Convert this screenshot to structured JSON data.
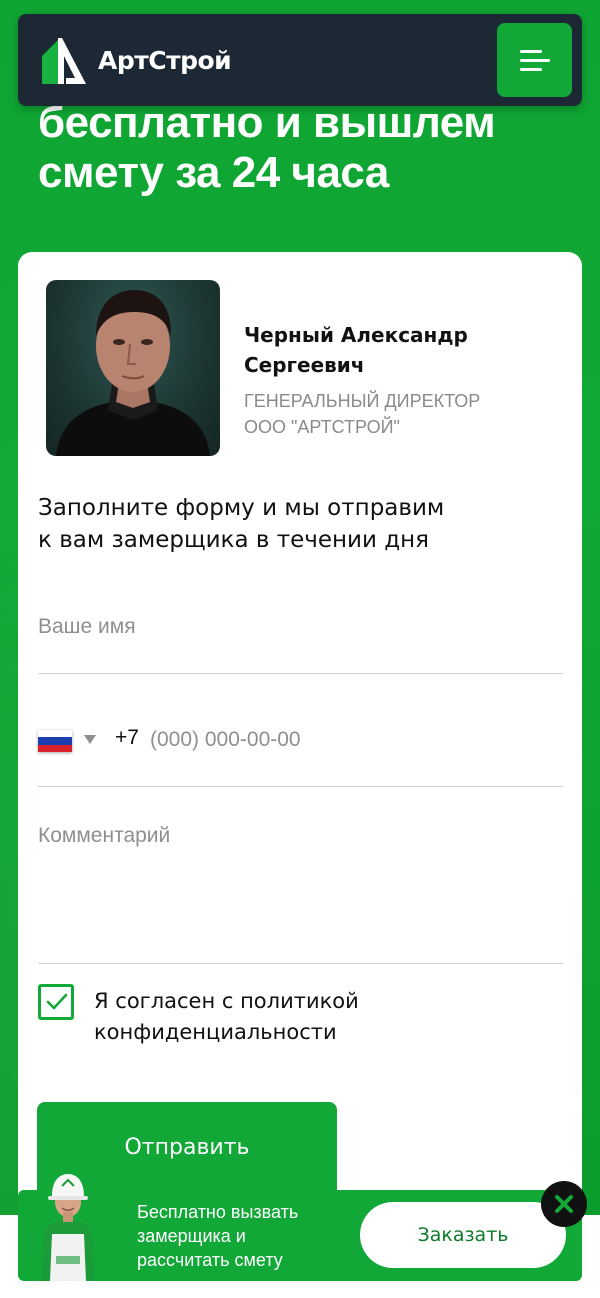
{
  "hero": {
    "title_line1": "бесплатно и вышлем",
    "title_line2": "смету за 24 часа"
  },
  "header": {
    "logo_text": "АртСтрой",
    "menu_icon": "hamburger-menu-icon"
  },
  "person": {
    "name_line1": "Черный Александр",
    "name_line2": "Сергеевич",
    "role_line1": "ГЕНЕРАЛЬНЫЙ ДИРЕКТОР",
    "role_line2": "ООО \"АРТСТРОЙ\""
  },
  "form": {
    "intro_line1": "Заполните форму и мы отправим",
    "intro_line2": "к вам замерщика в течении дня",
    "name_placeholder": "Ваше имя",
    "phone_country": "RU",
    "phone_dial_code": "+7",
    "phone_placeholder": "(000) 000-00-00",
    "comment_placeholder": "Комментарий",
    "consent_checked": true,
    "consent_line1": "Я согласен с политикой",
    "consent_line2": "конфиденциальности",
    "submit_label": "Отправить"
  },
  "bottom_bar": {
    "promo_line1": "Бесплатно вызвать",
    "promo_line2": "замерщика и",
    "promo_line3": "рассчитать смету",
    "order_label": "Заказать",
    "close_icon": "close-icon"
  },
  "colors": {
    "brand_green": "#12a838",
    "header_dark": "#1c2834",
    "text_dark": "#111111",
    "muted_gray": "#8a8a8a"
  }
}
